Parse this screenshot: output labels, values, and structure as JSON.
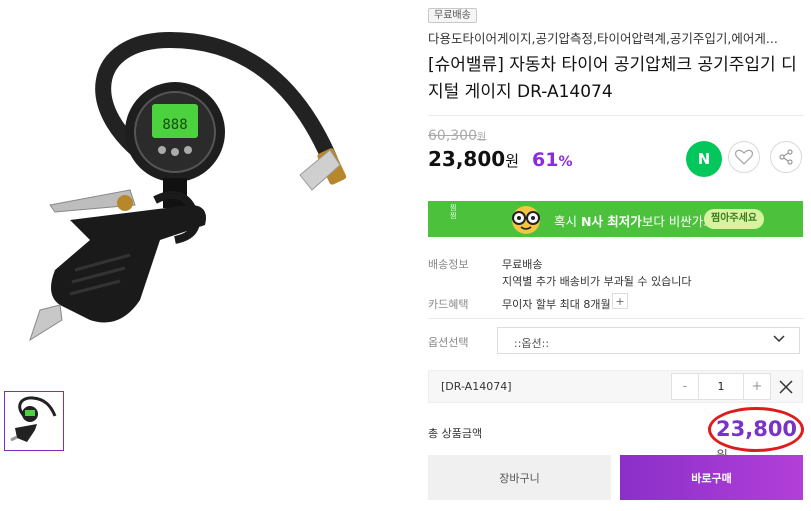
{
  "gallery": {
    "main_image_alt": "tire inflator digital gauge",
    "thumbnail_alt": "thumbnail 1"
  },
  "product": {
    "badge": "무료배송",
    "keywords": "다용도타이어게이지,공기압측정,타이어압력계,공기주입기,에어게...",
    "title": "[슈어밸류] 자동차 타이어 공기압체크 공기주입기 디지털 게이지 DR-A14074",
    "original_price": "60,300",
    "original_won": "원",
    "sale_price": "23,800",
    "sale_won": "원",
    "discount_number": "61",
    "discount_pct": "%"
  },
  "actions": {
    "n_label": "N",
    "like_icon": "heart-icon",
    "share_icon": "share-icon"
  },
  "banner": {
    "side_text": "찜 찜",
    "msg_prefix": "혹시 ",
    "msg_bold": "N사 최저가",
    "msg_suffix": "보다 비싼가요?",
    "button": "찜아주세요"
  },
  "info": {
    "shipping_label": "배송정보",
    "shipping_value": "무료배송",
    "shipping_note": "지역별 추가 배송비가 부과될 수 있습니다",
    "card_label": "카드혜택",
    "card_value": "무이자 할부 최대 8개월",
    "card_plus": "+"
  },
  "option": {
    "label": "옵션선택",
    "placeholder": "::옵션::",
    "selected_name": "[DR-A14074]",
    "minus": "-",
    "quantity": "1",
    "plus": "+"
  },
  "total": {
    "label": "총 상품금액",
    "price": "23,800",
    "won": "원"
  },
  "buttons": {
    "cart": "장바구니",
    "buy": "바로구매"
  },
  "colors": {
    "accent_purple": "#8a2be2",
    "naver_green": "#03c75a",
    "banner_green": "#4cc13c",
    "highlight_red": "#e01b1b"
  }
}
